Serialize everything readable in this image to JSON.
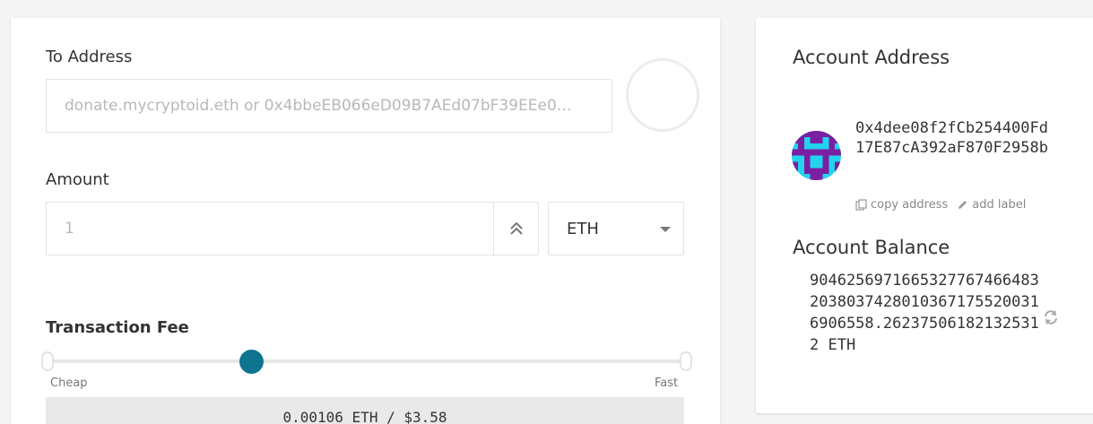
{
  "send": {
    "to_label": "To Address",
    "to_placeholder": "donate.mycryptoid.eth or 0x4bbeEB066eD09B7AEd07bF39EEe0…",
    "amount_label": "Amount",
    "amount_placeholder": "1",
    "unit": "ETH",
    "fee_label": "Transaction Fee",
    "fee_slider_value": 0.33,
    "cheap_label": "Cheap",
    "fast_label": "Fast",
    "fee_display": "0.00106 ETH / $3.58"
  },
  "account": {
    "address_label": "Account Address",
    "address": "0x4dee08f2fCb254400Fd17E87cA392aF870F2958b",
    "copy_label": "copy address",
    "add_label": "add label",
    "balance_label": "Account Balance",
    "balance": "904625697166532776746648320380374280103671755200316906558.262375061821325312 ETH"
  },
  "icons": {
    "to_identicon": "identicon-empty",
    "max_button": "chevron-double-up-icon",
    "unit_caret": "caret-down-icon",
    "copy": "copy-icon",
    "edit": "pencil-icon",
    "refresh": "refresh-icon",
    "avatar": "identicon-avatar"
  },
  "colors": {
    "accent": "#0e7490",
    "avatar_purple": "#7b1fa2",
    "avatar_cyan": "#22d3ee"
  }
}
